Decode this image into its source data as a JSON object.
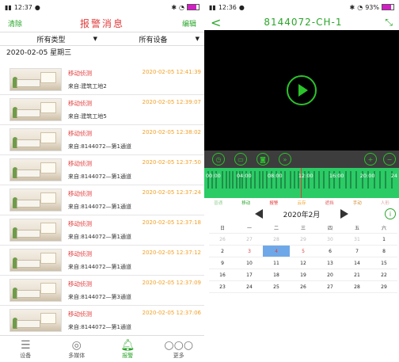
{
  "left": {
    "status": {
      "time": "12:37"
    },
    "header": {
      "clear": "清除",
      "title": "报警消息",
      "edit": "编辑"
    },
    "filters": [
      {
        "label": "所有类型",
        "arrow": "▼"
      },
      {
        "label": "所有设备",
        "arrow": "▼"
      }
    ],
    "date_header": "2020-02-05  星期三",
    "alerts": [
      {
        "type": "移动侦测",
        "time": "2020-02-05 12:41:39",
        "source": "来自:建筑工地2"
      },
      {
        "type": "移动侦测",
        "time": "2020-02-05 12:39:07",
        "source": "来自:建筑工地5"
      },
      {
        "type": "移动侦测",
        "time": "2020-02-05 12:38:02",
        "source": "来自:8144072—第1通道"
      },
      {
        "type": "移动侦测",
        "time": "2020-02-05 12:37:50",
        "source": "来自:8144072—第1通道"
      },
      {
        "type": "移动侦测",
        "time": "2020-02-05 12:37:24",
        "source": "来自:8144072—第1通道"
      },
      {
        "type": "移动侦测",
        "time": "2020-02-05 12:37:18",
        "source": "来自:8144072—第1通道"
      },
      {
        "type": "移动侦测",
        "time": "2020-02-05 12:37:12",
        "source": "来自:8144072—第1通道"
      },
      {
        "type": "移动侦测",
        "time": "2020-02-05 12:37:09",
        "source": "来自:8144072—第3通道"
      },
      {
        "type": "移动侦测",
        "time": "2020-02-05 12:37:06",
        "source": "来自:8144072—第1通道"
      }
    ],
    "nav": [
      {
        "label": "设备",
        "icon": "list-icon"
      },
      {
        "label": "多媒体",
        "icon": "aperture-icon"
      },
      {
        "label": "报警",
        "icon": "bell-icon"
      },
      {
        "label": "更多",
        "icon": "more-icon"
      }
    ]
  },
  "right": {
    "status": {
      "time": "12:36",
      "battery": "93%"
    },
    "title": "8144072-CH-1",
    "timeline_labels": [
      "00:00",
      "04:00",
      "08:00",
      "12:00",
      "16:00",
      "20:00",
      "24"
    ],
    "legend": [
      "普通",
      "移动",
      "报警",
      "云存",
      "遮挡",
      "手动",
      "人形"
    ],
    "calendar": {
      "month": "2020年2月",
      "weekdays": [
        "日",
        "一",
        "二",
        "三",
        "四",
        "五",
        "六"
      ],
      "weeks": [
        [
          "26",
          "27",
          "28",
          "29",
          "30",
          "31",
          "1"
        ],
        [
          "2",
          "3",
          "4",
          "5",
          "6",
          "7",
          "8"
        ],
        [
          "9",
          "10",
          "11",
          "12",
          "13",
          "14",
          "15"
        ],
        [
          "16",
          "17",
          "18",
          "19",
          "20",
          "21",
          "22"
        ],
        [
          "23",
          "24",
          "25",
          "26",
          "27",
          "28",
          "29"
        ]
      ],
      "selected": "4"
    }
  },
  "colors": {
    "accent_green": "#2aa52a",
    "alert_red": "#e23b3b",
    "time_orange": "#f0a12a",
    "timeline_green": "#2bcb66"
  }
}
